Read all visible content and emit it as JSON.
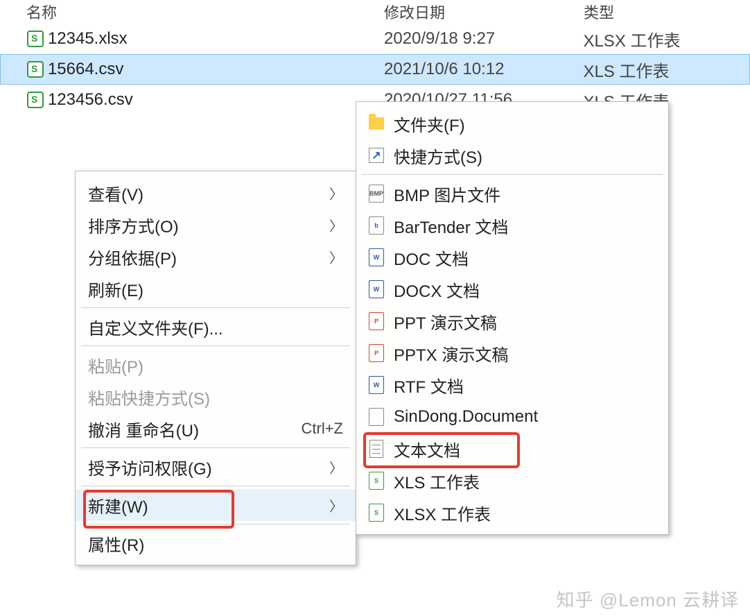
{
  "columns": {
    "name": "名称",
    "date": "修改日期",
    "type": "类型"
  },
  "files": [
    {
      "name": "12345.xlsx",
      "date": "2020/9/18 9:27",
      "type": "XLSX 工作表",
      "selected": false
    },
    {
      "name": "15664.csv",
      "date": "2021/10/6 10:12",
      "type": "XLS 工作表",
      "selected": true
    },
    {
      "name": "123456.csv",
      "date": "2020/10/27 11:56",
      "type": "XLS 工作表",
      "selected": false
    }
  ],
  "context_menu": {
    "view": "查看(V)",
    "sort": "排序方式(O)",
    "group": "分组依据(P)",
    "refresh": "刷新(E)",
    "customize": "自定义文件夹(F)...",
    "paste": "粘贴(P)",
    "paste_short": "粘贴快捷方式(S)",
    "undo": "撤消 重命名(U)",
    "undo_key": "Ctrl+Z",
    "grant": "授予访问权限(G)",
    "new": "新建(W)",
    "properties": "属性(R)"
  },
  "new_menu": {
    "folder": "文件夹(F)",
    "shortcut": "快捷方式(S)",
    "bmp": "BMP 图片文件",
    "bartender": "BarTender 文档",
    "doc": "DOC 文档",
    "docx": "DOCX 文档",
    "ppt": "PPT 演示文稿",
    "pptx": "PPTX 演示文稿",
    "rtf": "RTF 文档",
    "sindong": "SinDong.Document",
    "txt": "文本文档",
    "xls": "XLS 工作表",
    "xlsx": "XLSX 工作表"
  },
  "watermark": "知乎 @Lemon 云耕译"
}
